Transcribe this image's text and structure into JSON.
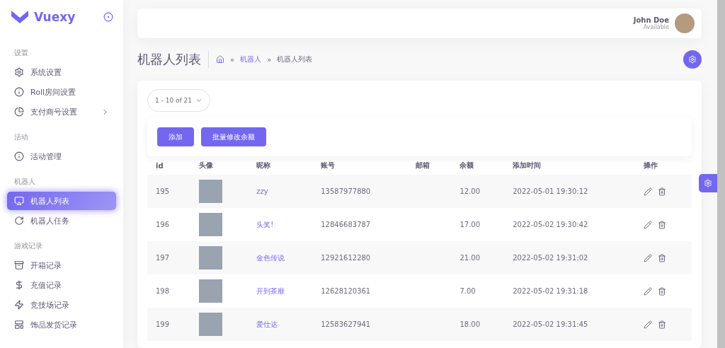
{
  "brand": {
    "name": "Vuexy"
  },
  "sidebar": {
    "sections": [
      {
        "title": "设置",
        "items": [
          {
            "label": "系统设置",
            "selected": false,
            "has_submenu": false
          },
          {
            "label": "Roll房间设置",
            "selected": false,
            "has_submenu": false
          },
          {
            "label": "支付商号设置",
            "selected": false,
            "has_submenu": true
          }
        ]
      },
      {
        "title": "活动",
        "items": [
          {
            "label": "活动管理",
            "selected": false,
            "has_submenu": false
          }
        ]
      },
      {
        "title": "机器人",
        "items": [
          {
            "label": "机器人列表",
            "selected": true,
            "has_submenu": false
          },
          {
            "label": "机器人任务",
            "selected": false,
            "has_submenu": false
          }
        ]
      },
      {
        "title": "游戏记录",
        "items": [
          {
            "label": "开箱记录",
            "selected": false,
            "has_submenu": false
          },
          {
            "label": "充值记录",
            "selected": false,
            "has_submenu": false
          },
          {
            "label": "竞技场记录",
            "selected": false,
            "has_submenu": false
          },
          {
            "label": "饰品发货记录",
            "selected": false,
            "has_submenu": false
          }
        ]
      }
    ]
  },
  "user": {
    "name": "John Doe",
    "status": "Available"
  },
  "page_title": "机器人列表",
  "breadcrumb": [
    {
      "label": "»",
      "kind": "separator"
    },
    {
      "label": "机器人",
      "kind": "link"
    },
    {
      "label": "»",
      "kind": "separator"
    },
    {
      "label": "机器人列表",
      "kind": "current"
    }
  ],
  "pagination": {
    "label": "1 - 10 of 21"
  },
  "buttons": [
    "添加",
    "批量修改余额"
  ],
  "table": {
    "columns": [
      "id",
      "头像",
      "昵称",
      "账号",
      "邮箱",
      "余额",
      "添加时间",
      "操作"
    ],
    "rows": [
      {
        "id": "195",
        "nickname": "zzy",
        "account": "13587977880",
        "balance": "12.00",
        "added": "2022-05-01 19:30:12"
      },
      {
        "id": "196",
        "nickname": "头奖!",
        "account": "12846683787",
        "balance": "17.00",
        "added": "2022-05-02 19:30:42"
      },
      {
        "id": "197",
        "nickname": "金色传说",
        "account": "12921612280",
        "balance": "21.00",
        "added": "2022-05-02 19:31:02"
      },
      {
        "id": "198",
        "nickname": "开到茶靡",
        "account": "12628120361",
        "balance": "7.00",
        "added": "2022-05-02 19:31:18"
      },
      {
        "id": "199",
        "nickname": "爱仕达",
        "account": "12583627941",
        "balance": "18.00",
        "added": "2022-05-02 19:31:45"
      }
    ]
  }
}
